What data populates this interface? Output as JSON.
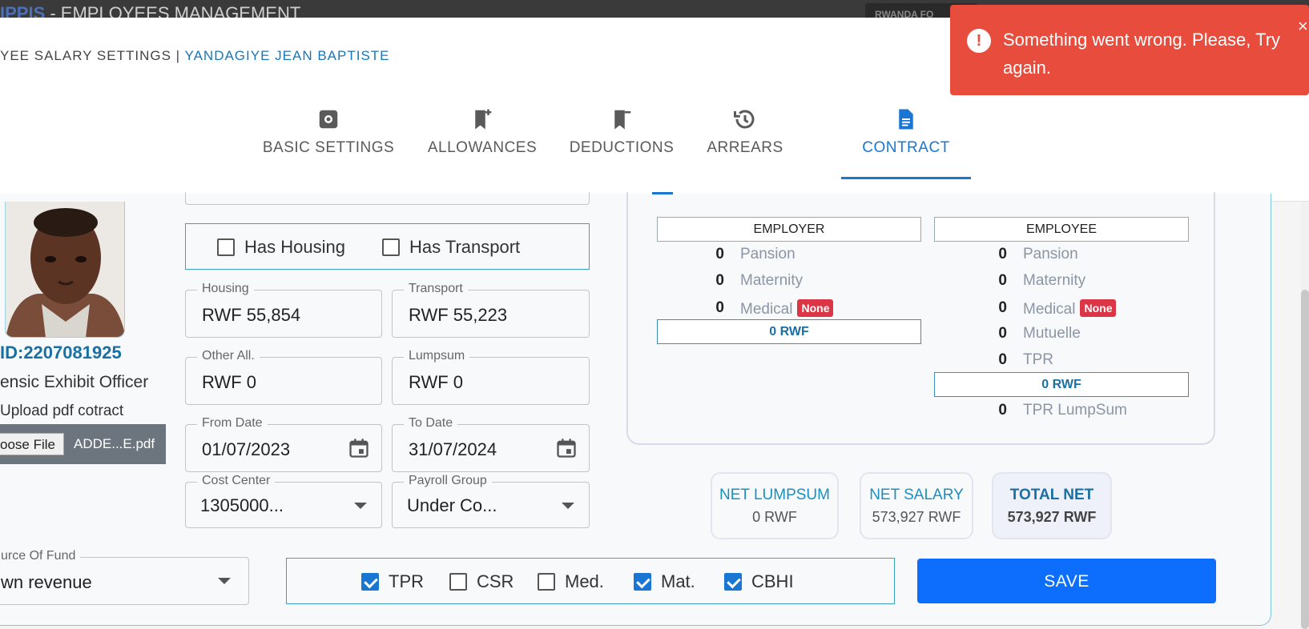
{
  "topbar": {
    "app_prefix": "IPPIS",
    "app_suffix": " - EMPLOYEES MANAGEMENT",
    "org_label": "RWANDA FO"
  },
  "modal": {
    "title_prefix": "YEE SALARY SETTINGS | ",
    "employee_name": "YANDAGIYE JEAN BAPTISTE"
  },
  "tabs": [
    {
      "label": "BASIC SETTINGS",
      "icon": "gear-icon",
      "active": false
    },
    {
      "label": "ALLOWANCES",
      "icon": "bookmark-plus-icon",
      "active": false
    },
    {
      "label": "DEDUCTIONS",
      "icon": "bookmark-minus-icon",
      "active": false
    },
    {
      "label": "ARREARS",
      "icon": "history-icon",
      "active": false
    },
    {
      "label": "CONTRACT",
      "icon": "document-icon",
      "active": true
    }
  ],
  "toast": {
    "message": "Something went wrong. Please, Try again.",
    "close": "×",
    "color": "#e74c3c"
  },
  "employee": {
    "id": "ID:2207081925",
    "position": "ensic Exhibit Officer",
    "upload_label": "Upload pdf cotract",
    "choose_file": "oose File",
    "file_name": "ADDE...E.pdf"
  },
  "flags": [
    {
      "label": "Has Housing",
      "checked": false
    },
    {
      "label": "Has Transport",
      "checked": false
    }
  ],
  "fields": {
    "housing": {
      "label": "Housing",
      "value": "RWF 55,854"
    },
    "transport": {
      "label": "Transport",
      "value": "RWF 55,223"
    },
    "other": {
      "label": "Other All.",
      "value": "RWF 0"
    },
    "lumpsum": {
      "label": "Lumpsum",
      "value": "RWF 0"
    },
    "from_date": {
      "label": "From Date",
      "value": "01/07/2023"
    },
    "to_date": {
      "label": "To Date",
      "value": "31/07/2024"
    },
    "cost_center": {
      "label": "Cost Center",
      "value": "1305000..."
    },
    "payroll_group": {
      "label": "Payroll Group",
      "value": "Under Co..."
    },
    "source_fund": {
      "label": "urce Of Fund",
      "value": "wn revenue"
    }
  },
  "contributions": {
    "employer": {
      "header": "EMPLOYER",
      "rows": [
        {
          "value": "0",
          "label": "Pansion"
        },
        {
          "value": "0",
          "label": "Maternity"
        },
        {
          "value": "0",
          "label": "Medical",
          "badge": "None"
        }
      ],
      "total": "0 RWF"
    },
    "employee": {
      "header": "EMPLOYEE",
      "rows": [
        {
          "value": "0",
          "label": "Pansion"
        },
        {
          "value": "0",
          "label": "Maternity"
        },
        {
          "value": "0",
          "label": "Medical",
          "badge": "None"
        },
        {
          "value": "0",
          "label": "Mutuelle"
        },
        {
          "value": "0",
          "label": "TPR"
        }
      ],
      "total": "0 RWF",
      "extra": {
        "value": "0",
        "label": "TPR LumpSum"
      }
    }
  },
  "summary": [
    {
      "title": "NET LUMPSUM",
      "value": "0 RWF"
    },
    {
      "title": "NET SALARY",
      "value": "573,927 RWF"
    },
    {
      "title": "TOTAL NET",
      "value": "573,927 RWF"
    }
  ],
  "options": [
    {
      "label": "TPR",
      "checked": true
    },
    {
      "label": "CSR",
      "checked": false
    },
    {
      "label": "Med.",
      "checked": false
    },
    {
      "label": "Mat.",
      "checked": true
    },
    {
      "label": "CBHI",
      "checked": true
    }
  ],
  "save_label": "SAVE"
}
